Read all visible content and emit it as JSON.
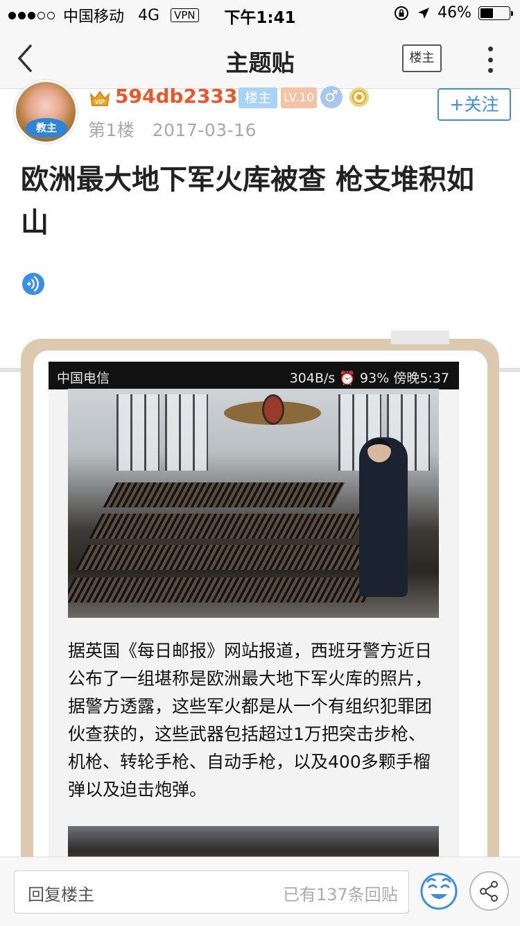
{
  "status_bar": {
    "carrier": "中国移动",
    "network": "4G",
    "vpn": "VPN",
    "time": "下午1:41",
    "battery": "46%"
  },
  "nav": {
    "title": "主题贴",
    "owner_button": "楼主"
  },
  "author": {
    "avatar_badge": "教主",
    "username": "594db2333",
    "tag_owner": "楼主",
    "tag_level": "LV.10",
    "gender_symbol": "♂",
    "floor": "第1楼",
    "date": "2017-03-16",
    "follow_button": "+关注"
  },
  "post": {
    "title": "欧洲最大地下军火库被查 枪支堆积如山"
  },
  "embedded_screenshot": {
    "carrier": "中国电信",
    "status_right": "304B/s ⏰ 93% 傍晚5:37",
    "article_text": "据英国《每日邮报》网站报道，西班牙警方近日公布了一组堪称是欧洲最大地下军火库的照片，据警方透露，这些军火都是从一个有组织犯罪团伙查获的，这些武器包括超过1万把突击步枪、机枪、转轮手枪、自动手枪，以及400多颗手榴弹以及迫击炮弹。"
  },
  "bottom_bar": {
    "reply_placeholder": "回复楼主",
    "reply_count": "已有137条回贴"
  },
  "colors": {
    "accent_blue": "#3a8ee6",
    "username_orange": "#e8582a",
    "frame_beige": "#dcc9b0"
  }
}
